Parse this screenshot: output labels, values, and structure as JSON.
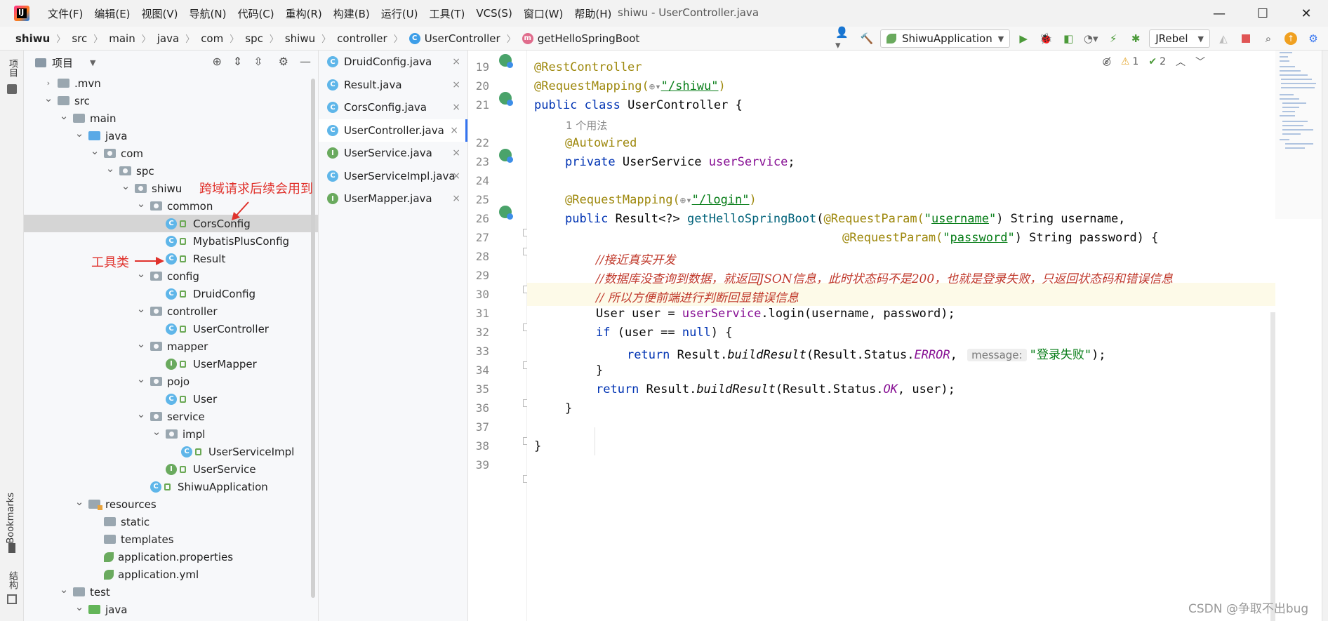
{
  "app": {
    "logo_letters": "IJ",
    "menu": [
      "文件(F)",
      "编辑(E)",
      "视图(V)",
      "导航(N)",
      "代码(C)",
      "重构(R)",
      "构建(B)",
      "运行(U)",
      "工具(T)",
      "VCS(S)",
      "窗口(W)",
      "帮助(H)"
    ],
    "window_title": "shiwu - UserController.java",
    "controls": {
      "minimize": "—",
      "maximize": "☐",
      "close": "✕"
    }
  },
  "breadcrumb": [
    "shiwu",
    "src",
    "main",
    "java",
    "com",
    "spc",
    "shiwu",
    "controller",
    "UserController",
    "getHelloSpringBoot"
  ],
  "toolbar": {
    "run_config": "ShiwuApplication",
    "jrebel": "JRebel"
  },
  "left_strip": {
    "project_label": "项目",
    "bookmarks_label": "Bookmarks",
    "structure_label": "结构"
  },
  "project_panel": {
    "title": "项目",
    "tree": [
      {
        "label": ".mvn",
        "depth": 1,
        "expand": "closed",
        "icon": "folder"
      },
      {
        "label": "src",
        "depth": 1,
        "expand": "open",
        "icon": "folder"
      },
      {
        "label": "main",
        "depth": 2,
        "expand": "open",
        "icon": "folder"
      },
      {
        "label": "java",
        "depth": 3,
        "expand": "open",
        "icon": "folder-blue"
      },
      {
        "label": "com",
        "depth": 4,
        "expand": "open",
        "icon": "package"
      },
      {
        "label": "spc",
        "depth": 5,
        "expand": "open",
        "icon": "package"
      },
      {
        "label": "shiwu",
        "depth": 6,
        "expand": "open",
        "icon": "package"
      },
      {
        "label": "common",
        "depth": 7,
        "expand": "open",
        "icon": "package"
      },
      {
        "label": "CorsConfig",
        "depth": 8,
        "expand": "none",
        "icon": "class",
        "selected": true
      },
      {
        "label": "MybatisPlusConfig",
        "depth": 8,
        "expand": "none",
        "icon": "class"
      },
      {
        "label": "Result",
        "depth": 8,
        "expand": "none",
        "icon": "class"
      },
      {
        "label": "config",
        "depth": 7,
        "expand": "open",
        "icon": "package"
      },
      {
        "label": "DruidConfig",
        "depth": 8,
        "expand": "none",
        "icon": "class"
      },
      {
        "label": "controller",
        "depth": 7,
        "expand": "open",
        "icon": "package"
      },
      {
        "label": "UserController",
        "depth": 8,
        "expand": "none",
        "icon": "class"
      },
      {
        "label": "mapper",
        "depth": 7,
        "expand": "open",
        "icon": "package"
      },
      {
        "label": "UserMapper",
        "depth": 8,
        "expand": "none",
        "icon": "interface"
      },
      {
        "label": "pojo",
        "depth": 7,
        "expand": "open",
        "icon": "package"
      },
      {
        "label": "User",
        "depth": 8,
        "expand": "none",
        "icon": "class"
      },
      {
        "label": "service",
        "depth": 7,
        "expand": "open",
        "icon": "package"
      },
      {
        "label": "impl",
        "depth": 8,
        "expand": "open",
        "icon": "package"
      },
      {
        "label": "UserServiceImpl",
        "depth": 9,
        "expand": "none",
        "icon": "class"
      },
      {
        "label": "UserService",
        "depth": 8,
        "expand": "none",
        "icon": "interface"
      },
      {
        "label": "ShiwuApplication",
        "depth": 7,
        "expand": "none",
        "icon": "spring-class"
      },
      {
        "label": "resources",
        "depth": 3,
        "expand": "open",
        "icon": "folder-res"
      },
      {
        "label": "static",
        "depth": 4,
        "expand": "none",
        "icon": "folder"
      },
      {
        "label": "templates",
        "depth": 4,
        "expand": "none",
        "icon": "folder"
      },
      {
        "label": "application.properties",
        "depth": 4,
        "expand": "none",
        "icon": "spring-file"
      },
      {
        "label": "application.yml",
        "depth": 4,
        "expand": "none",
        "icon": "spring-file"
      },
      {
        "label": "test",
        "depth": 2,
        "expand": "open",
        "icon": "folder"
      },
      {
        "label": "java",
        "depth": 3,
        "expand": "open",
        "icon": "folder-green"
      }
    ],
    "annotations": {
      "cors_note": "跨域请求后续会用到",
      "tool_note": "工具类"
    }
  },
  "open_files": [
    {
      "name": "DruidConfig.java",
      "icon": "class"
    },
    {
      "name": "Result.java",
      "icon": "class"
    },
    {
      "name": "CorsConfig.java",
      "icon": "class"
    },
    {
      "name": "UserController.java",
      "icon": "class",
      "active": true
    },
    {
      "name": "UserService.java",
      "icon": "interface"
    },
    {
      "name": "UserServiceImpl.java",
      "icon": "class"
    },
    {
      "name": "UserMapper.java",
      "icon": "interface"
    }
  ],
  "editor": {
    "status": {
      "warnings": "1",
      "checks": "2"
    },
    "line_numbers": [
      "19",
      "20",
      "21",
      "",
      "22",
      "23",
      "24",
      "25",
      "26",
      "27",
      "28",
      "29",
      "30",
      "31",
      "32",
      "33",
      "34",
      "35",
      "36",
      "37",
      "38",
      "39"
    ],
    "usage_hint": "1 个用法",
    "lines": {
      "l19": "@RestController",
      "l20_a": "@RequestMapping(",
      "l20_path": "\"/shiwu\"",
      "l20_b": ")",
      "l21_kw": "public class ",
      "l21_name": "UserController {",
      "l22": "@Autowired",
      "l23_kw": "private ",
      "l23_type": "UserService ",
      "l23_field": "userService",
      "l23_end": ";",
      "l25_a": "@RequestMapping(",
      "l25_path": "\"/login\"",
      "l25_b": ")",
      "l26_kw": "public ",
      "l26_type": "Result<?> ",
      "l26_method": "getHelloSpringBoot",
      "l26_p1": "(",
      "l26_ann": "@RequestParam(",
      "l26_str_q1": "\"",
      "l26_str": "username",
      "l26_str_q2": "\"",
      "l26_rest": ") String username,",
      "l27_ann": "@RequestParam(",
      "l27_str_q1": "\"",
      "l27_str": "password",
      "l27_str_q2": "\"",
      "l27_rest": ") String password) {",
      "l28": "//接近真实开发",
      "l29": "//数据库没查询到数据，就返回JSON信息，此时状态码不是200，也就是登录失败，只返回状态码和错误信息",
      "l30": "// 所以方便前端进行判断回显错误信息",
      "l31_a": "User user = ",
      "l31_field": "userService",
      "l31_b": ".login(username, password);",
      "l32_kw": "if ",
      "l32_a": "(user == ",
      "l32_null": "null",
      "l32_b": ") {",
      "l33_kw": "return ",
      "l33_a": "Result.",
      "l33_m": "buildResult",
      "l33_b": "(Result.Status.",
      "l33_enum": "ERROR",
      "l33_c": ", ",
      "l33_hint": "message:",
      "l33_str": "\"登录失败\"",
      "l33_d": ");",
      "l34": "}",
      "l35_kw": "return ",
      "l35_a": "Result.",
      "l35_m": "buildResult",
      "l35_b": "(Result.Status.",
      "l35_enum": "OK",
      "l35_c": ", user);",
      "l36": "}",
      "l38": "}"
    }
  },
  "watermark": "CSDN @争取不出bug"
}
